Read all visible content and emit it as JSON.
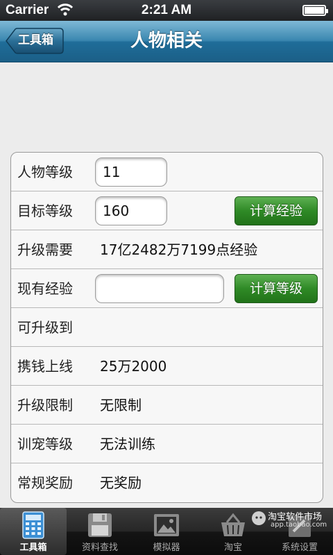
{
  "status_bar": {
    "carrier": "Carrier",
    "time": "2:21 AM"
  },
  "nav": {
    "back_label": "工具箱",
    "title": "人物相关"
  },
  "form": {
    "rows": [
      {
        "label": "人物等级",
        "input_value": "11"
      },
      {
        "label": "目标等级",
        "input_value": "160",
        "button": "计算经验"
      },
      {
        "label": "升级需要",
        "value": "17亿2482万7199点经验"
      },
      {
        "label": "现有经验",
        "input_value": "",
        "button": "计算等级"
      },
      {
        "label": "可升级到",
        "value": ""
      },
      {
        "label": "携钱上线",
        "value": "25万2000"
      },
      {
        "label": "升级限制",
        "value": "无限制"
      },
      {
        "label": "训宠等级",
        "value": "无法训练"
      },
      {
        "label": "常规奖励",
        "value": "无奖励"
      }
    ]
  },
  "tab_bar": {
    "tabs": [
      {
        "label": "工具箱",
        "icon": "calculator-icon",
        "active": true
      },
      {
        "label": "资料查找",
        "icon": "floppy-disk-icon",
        "active": false
      },
      {
        "label": "模拟器",
        "icon": "picture-icon",
        "active": false
      },
      {
        "label": "淘宝",
        "icon": "basket-icon",
        "active": false
      },
      {
        "label": "系统设置",
        "icon": "settings-icon",
        "active": false
      }
    ]
  },
  "watermark": {
    "text": "淘宝软件市场",
    "url": "app.taobao.com"
  },
  "colors": {
    "nav_blue": "#1f6d99",
    "button_green": "#2f8a26"
  }
}
